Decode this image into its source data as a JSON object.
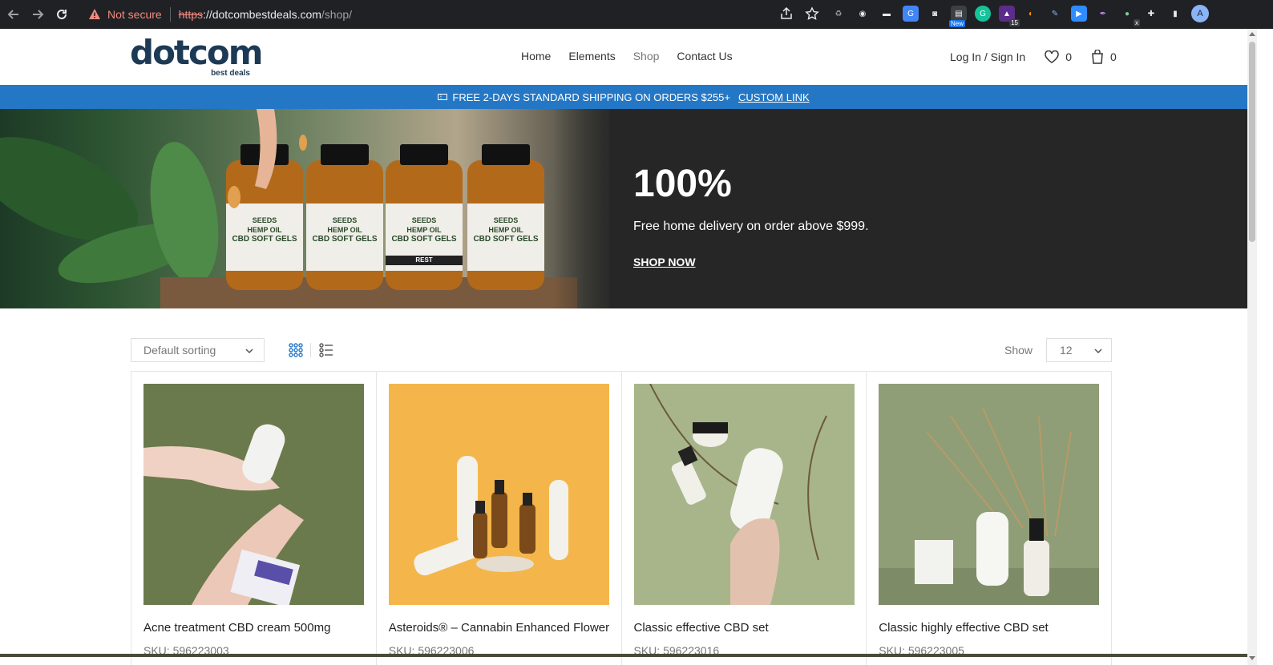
{
  "browser": {
    "security_label": "Not secure",
    "url_scheme": "https",
    "url_host": "://dotcombestdeals.com",
    "url_path": "/shop/",
    "ext_badge_new": "New",
    "ext_badge_count": "15",
    "ext_badge_x": "x",
    "avatar_letter": "A"
  },
  "header": {
    "logo_main": "dotcom",
    "logo_sub": "best deals",
    "menu": [
      "Home",
      "Elements",
      "Shop",
      "Contact Us"
    ],
    "login": "Log In / Sign In",
    "wishlist_count": "0",
    "cart_count": "0"
  },
  "promo": {
    "text": "FREE 2-DAYS STANDARD SHIPPING ON ORDERS $255+",
    "link": "CUSTOM LINK"
  },
  "hero": {
    "title": "100%",
    "subtitle": "Free home delivery on order above $999.",
    "cta": "SHOP NOW",
    "bottle_brand": "SEEDS",
    "bottle_line1": "HEMP OIL",
    "bottle_line2": "CBD SOFT GELS",
    "bottle_tag": "REST"
  },
  "toolbar": {
    "sorting": "Default sorting",
    "show_label": "Show",
    "per_page": "12"
  },
  "products": [
    {
      "title": "Acne treatment CBD cream 500mg",
      "sku": "SKU: 596223003"
    },
    {
      "title": "Asteroids® – Cannabin Enhanced Flower",
      "sku": "SKU: 596223006"
    },
    {
      "title": "Classic effective CBD set",
      "sku": "SKU: 596223016"
    },
    {
      "title": "Classic highly effective CBD set",
      "sku": "SKU: 596223005"
    }
  ],
  "colors": {
    "brand_blue": "#2477c5",
    "logo_navy": "#1c3a55",
    "hero_bg": "#262626"
  }
}
